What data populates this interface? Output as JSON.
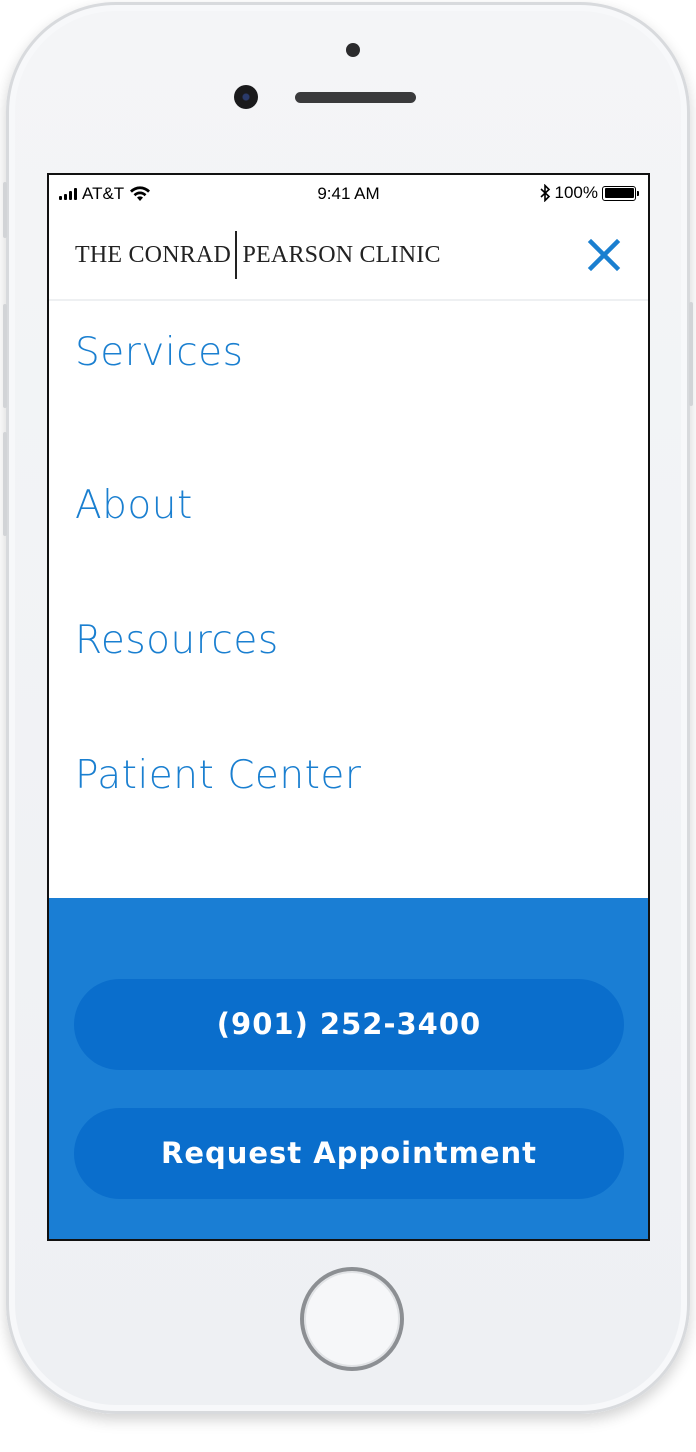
{
  "status_bar": {
    "carrier": "AT&T",
    "time": "9:41 AM",
    "battery": "100%",
    "signal_icon": "signal-bars-icon",
    "wifi_icon": "wifi-icon",
    "bluetooth_icon": "bluetooth-icon",
    "battery_icon": "battery-icon"
  },
  "header": {
    "logo_left": "THE CONRAD",
    "logo_right": "PEARSON CLINIC",
    "close_icon": "close-icon",
    "accent_color": "#1a7fd0"
  },
  "nav": {
    "items": [
      {
        "label": "Services"
      },
      {
        "label": "About"
      },
      {
        "label": "Resources"
      },
      {
        "label": "Patient Center"
      }
    ]
  },
  "cta": {
    "phone_label": "(901) 252-3400",
    "appointment_label": "Request Appointment",
    "panel_color": "#1a7ed4",
    "button_color": "#0a6ecc"
  }
}
